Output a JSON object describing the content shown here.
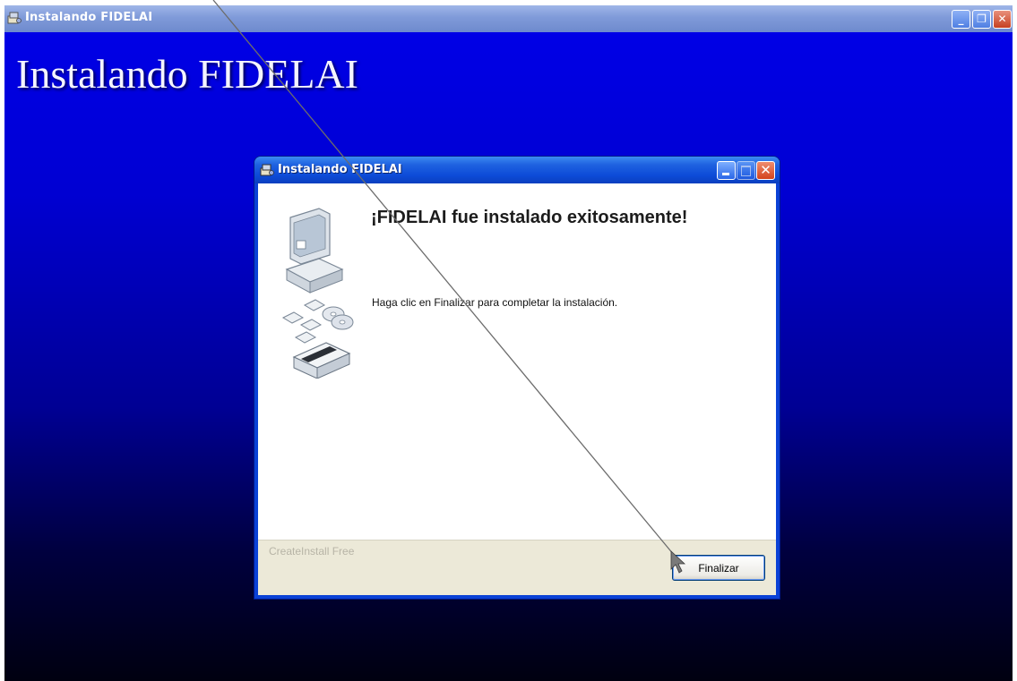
{
  "outer_window": {
    "title": "Instalando FIDELAI",
    "big_title": "Instalando FIDELAI",
    "controls": {
      "minimize": "_",
      "restore": "❐",
      "close": "✕"
    }
  },
  "dialog": {
    "title": "Instalando FIDELAI",
    "heading": "¡FIDELAI fue instalado exitosamente!",
    "message": "Haga clic en Finalizar para completar la instalación.",
    "brand": "CreateInstall Free",
    "finish_label": "Finalizar",
    "close_glyph": "✕"
  },
  "colors": {
    "background_top": "#0000e6",
    "background_bottom": "#000010",
    "dialog_frame": "#0a41d6",
    "footer": "#ece9d8"
  },
  "icons": {
    "app": "installer-icon",
    "illustration": "computer-disks-package-icon",
    "cursor": "mouse-pointer-icon"
  }
}
